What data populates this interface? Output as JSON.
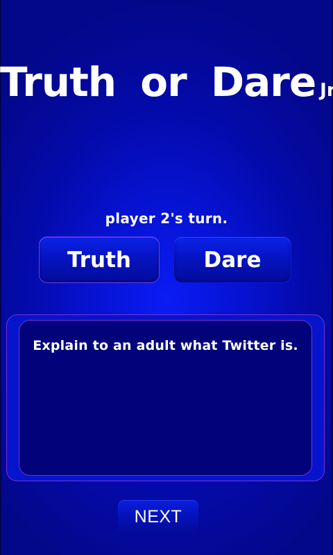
{
  "app": {
    "title_main": "Truth or Dare",
    "title_suffix": "Jr."
  },
  "game": {
    "turn_label": "player 2's turn.",
    "truth_button": "Truth",
    "dare_button": "Dare",
    "prompt_text": "Explain to an adult what Twitter is.",
    "next_button": "NEXT"
  },
  "colors": {
    "background": "#0612d0",
    "card_inner": "#02037a",
    "border_accent": "#7a2fd8",
    "text": "#ffffff"
  }
}
